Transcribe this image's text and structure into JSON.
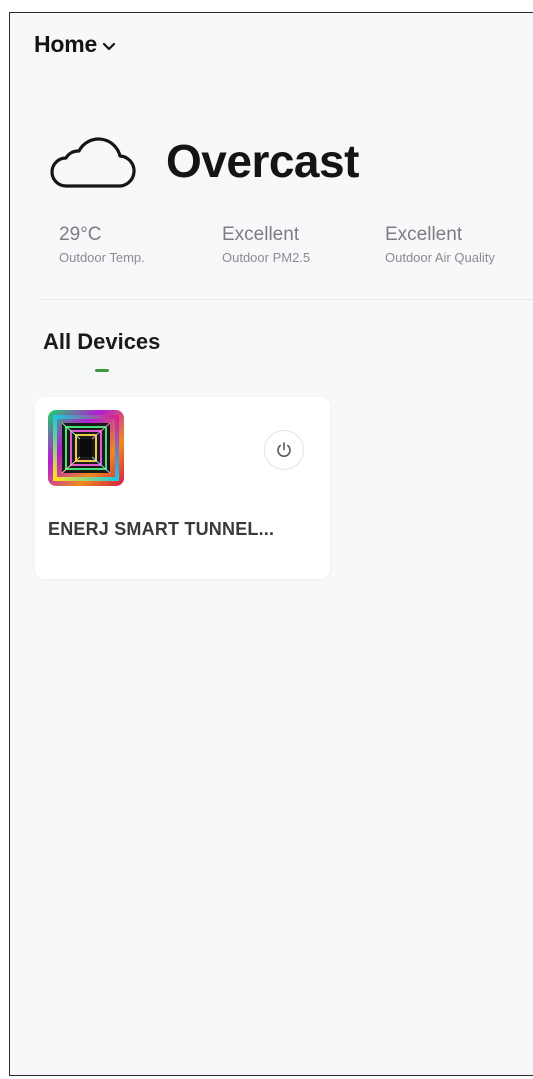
{
  "header": {
    "home_label": "Home",
    "home_dropdown_icon": "chevron-down-icon"
  },
  "weather": {
    "icon": "cloud-icon",
    "condition": "Overcast",
    "stats": [
      {
        "value": "29°C",
        "label": "Outdoor Temp."
      },
      {
        "value": "Excellent",
        "label": "Outdoor PM2.5"
      },
      {
        "value": "Excellent",
        "label": "Outdoor Air Quality"
      }
    ]
  },
  "devices_section": {
    "tab_label": "All Devices",
    "active_tab_color": "#3d9a3f",
    "devices": [
      {
        "name": "ENERJ SMART TUNNEL...",
        "thumbnail": "rgb-tunnel-light-thumbnail",
        "power_icon": "power-icon"
      }
    ]
  },
  "colors": {
    "background": "#f7f8fa",
    "card": "#ffffff",
    "accent_green": "#3d9a3f"
  }
}
